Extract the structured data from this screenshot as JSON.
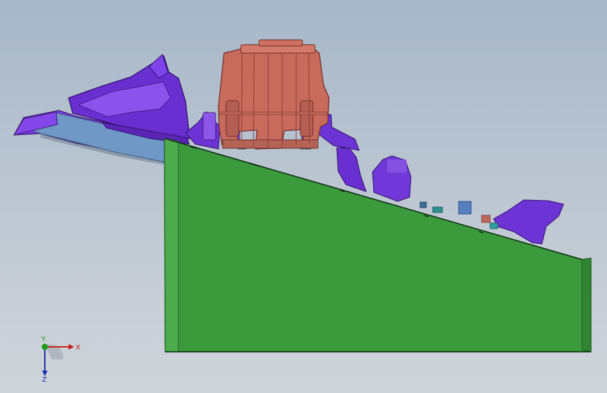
{
  "viewport": {
    "background_top": "#a7b7c8",
    "background_bottom": "#cfd4d9"
  },
  "model": {
    "colors": {
      "base_block": "#3a9a3c",
      "base_edge": "#2f7f31",
      "rear_housing": "#6a2fd0",
      "cylinder": "#c86a5c",
      "blue_panel": "#6f98c6"
    }
  },
  "triad": {
    "x_label": "X",
    "y_label": "Y",
    "z_label": "Z",
    "x_color": "#c81e1e",
    "y_color": "#1e9a1e",
    "z_color": "#2030b0"
  }
}
